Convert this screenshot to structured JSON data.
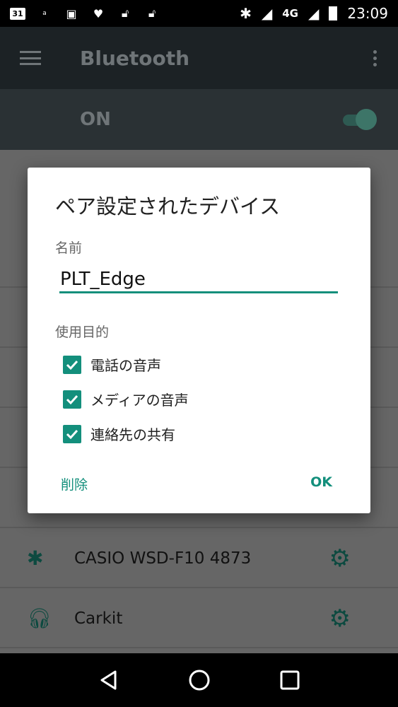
{
  "status_bar": {
    "left_icons": [
      "calendar-icon",
      "amazon-icon",
      "image-icon",
      "heart-icon",
      "unlock-icon",
      "unlock-icon"
    ],
    "calendar_day": "31",
    "network": "4G",
    "time": "23:09"
  },
  "toolbar": {
    "title": "Bluetooth"
  },
  "bluetooth_switch": {
    "label": "ON",
    "enabled": true
  },
  "devices": [
    {
      "name": "CASIO WSD-F10 4873",
      "icon": "bluetooth-icon"
    },
    {
      "name": "Carkit",
      "icon": "headset-icon"
    }
  ],
  "dialog": {
    "title": "ペア設定されたデバイス",
    "name_label": "名前",
    "name_value": "PLT_Edge",
    "usage_label": "使用目的",
    "options": [
      {
        "label": "電話の音声",
        "checked": true
      },
      {
        "label": "メディアの音声",
        "checked": true
      },
      {
        "label": "連絡先の共有",
        "checked": true
      }
    ],
    "delete_label": "削除",
    "ok_label": "OK"
  },
  "colors": {
    "accent": "#138f7c",
    "scrim_background": "#666666"
  }
}
